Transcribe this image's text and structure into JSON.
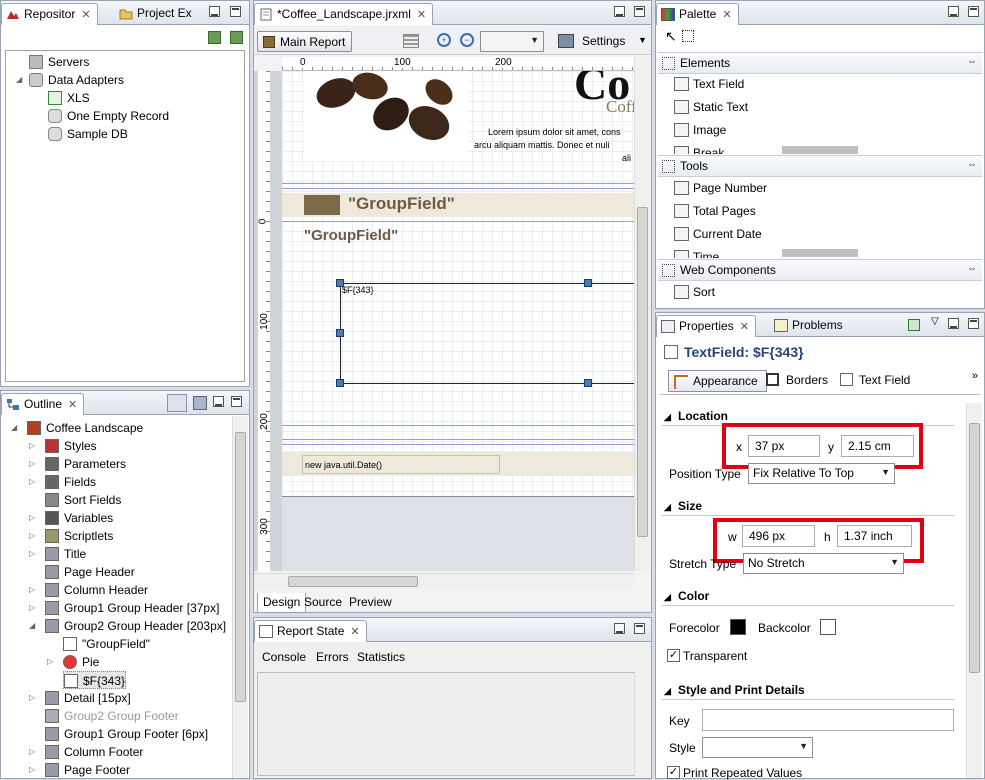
{
  "repository": {
    "tabs": [
      {
        "label": "Repositor"
      },
      {
        "label": "Project Ex"
      }
    ],
    "items": [
      "Servers",
      "Data Adapters",
      "XLS",
      "One Empty Record",
      "Sample DB"
    ]
  },
  "outline": {
    "tab": "Outline",
    "items": [
      "Coffee Landscape",
      "Styles",
      "Parameters",
      "Fields",
      "Sort Fields",
      "Variables",
      "Scriptlets",
      "Title",
      "Page Header",
      "Column Header",
      "Group1 Group Header [37px]",
      "Group2 Group Header [203px]",
      "\"GroupField\"",
      "Pie",
      "$F{343}",
      "Detail [15px]",
      "Group2 Group Footer",
      "Group1 Group Footer [6px]",
      "Column Footer",
      "Page Footer"
    ]
  },
  "editor": {
    "tab": "*Coffee_Landscape.jrxml",
    "main_report": "Main Report",
    "settings": "Settings",
    "ruler_h": [
      "0",
      "100",
      "200"
    ],
    "ruler_v": [
      "0",
      "100",
      "200",
      "300"
    ],
    "canvas": {
      "title_fragment": "Co",
      "subtitle_fragment": "Coff",
      "lorem1": "Lorem ipsum dolor sit amet, cons",
      "lorem2": "arcu aliquam mattis. Donec et nuli",
      "lorem3": "ali",
      "group_field_1": "\"GroupField\"",
      "group_field_2": "\"GroupField\"",
      "field_expr": "$F{343}",
      "date_expr": "new java.util.Date()"
    },
    "bottom_tabs": [
      "Design",
      "Source",
      "Preview"
    ]
  },
  "report_state": {
    "tab": "Report State",
    "links": [
      "Console",
      "Errors",
      "Statistics"
    ]
  },
  "palette": {
    "tab": "Palette",
    "sections": [
      {
        "title": "Elements",
        "items": [
          "Text Field",
          "Static Text",
          "Image",
          "Break"
        ]
      },
      {
        "title": "Tools",
        "items": [
          "Page Number",
          "Total Pages",
          "Current Date",
          "Time"
        ]
      },
      {
        "title": "Web Components",
        "items": [
          "Sort"
        ]
      }
    ]
  },
  "properties": {
    "tabs": [
      "Properties",
      "Problems"
    ],
    "header": "TextField: $F{343}",
    "subtabs": [
      "Appearance",
      "Borders",
      "Text Field"
    ],
    "location": {
      "title": "Location",
      "x_label": "x",
      "x_value": "37 px",
      "y_label": "y",
      "y_value": "2.15 cm",
      "position_type_label": "Position Type",
      "position_type_value": "Fix Relative To Top"
    },
    "size": {
      "title": "Size",
      "w_label": "w",
      "w_value": "496 px",
      "h_label": "h",
      "h_value": "1.37 inch",
      "stretch_type_label": "Stretch Type",
      "stretch_type_value": "No Stretch"
    },
    "color": {
      "title": "Color",
      "forecolor_label": "Forecolor",
      "forecolor": "#000000",
      "backcolor_label": "Backcolor",
      "backcolor": "#ffffff",
      "transparent_label": "Transparent"
    },
    "style_print": {
      "title": "Style and Print Details",
      "key_label": "Key",
      "style_label": "Style",
      "print_repeated_label": "Print Repeated Values"
    }
  },
  "colors": {
    "highlight": "#e00012",
    "group_band": "#efe9dc",
    "group_text": "#6b5b45"
  }
}
